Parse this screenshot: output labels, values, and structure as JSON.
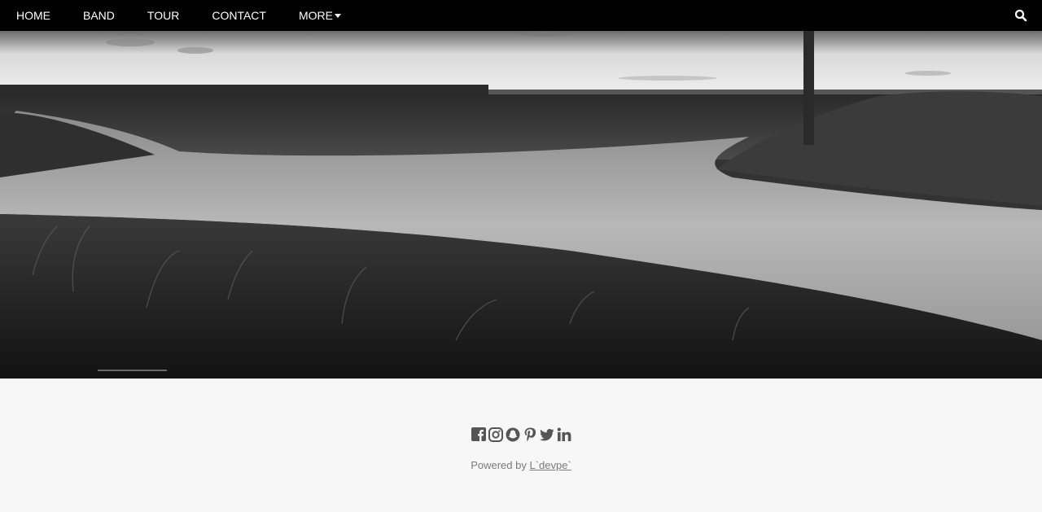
{
  "nav": {
    "items": [
      {
        "label": "HOME"
      },
      {
        "label": "BAND"
      },
      {
        "label": "TOUR"
      },
      {
        "label": "CONTACT"
      },
      {
        "label": "MORE"
      }
    ],
    "search_icon": "search-icon"
  },
  "hero": {
    "image": "black-and-white-country-crossroads-photo"
  },
  "footer": {
    "social_icons": [
      "facebook-icon",
      "instagram-icon",
      "snapchat-icon",
      "pinterest-icon",
      "twitter-icon",
      "linkedin-icon"
    ],
    "powered_prefix": "Powered by ",
    "powered_link": "L`devpe`"
  },
  "colors": {
    "navbar_bg": "#000000",
    "nav_text": "#ffffff",
    "footer_bg": "#f7f7f7",
    "footer_text": "#7a7a7a",
    "social_icon": "#555555"
  }
}
